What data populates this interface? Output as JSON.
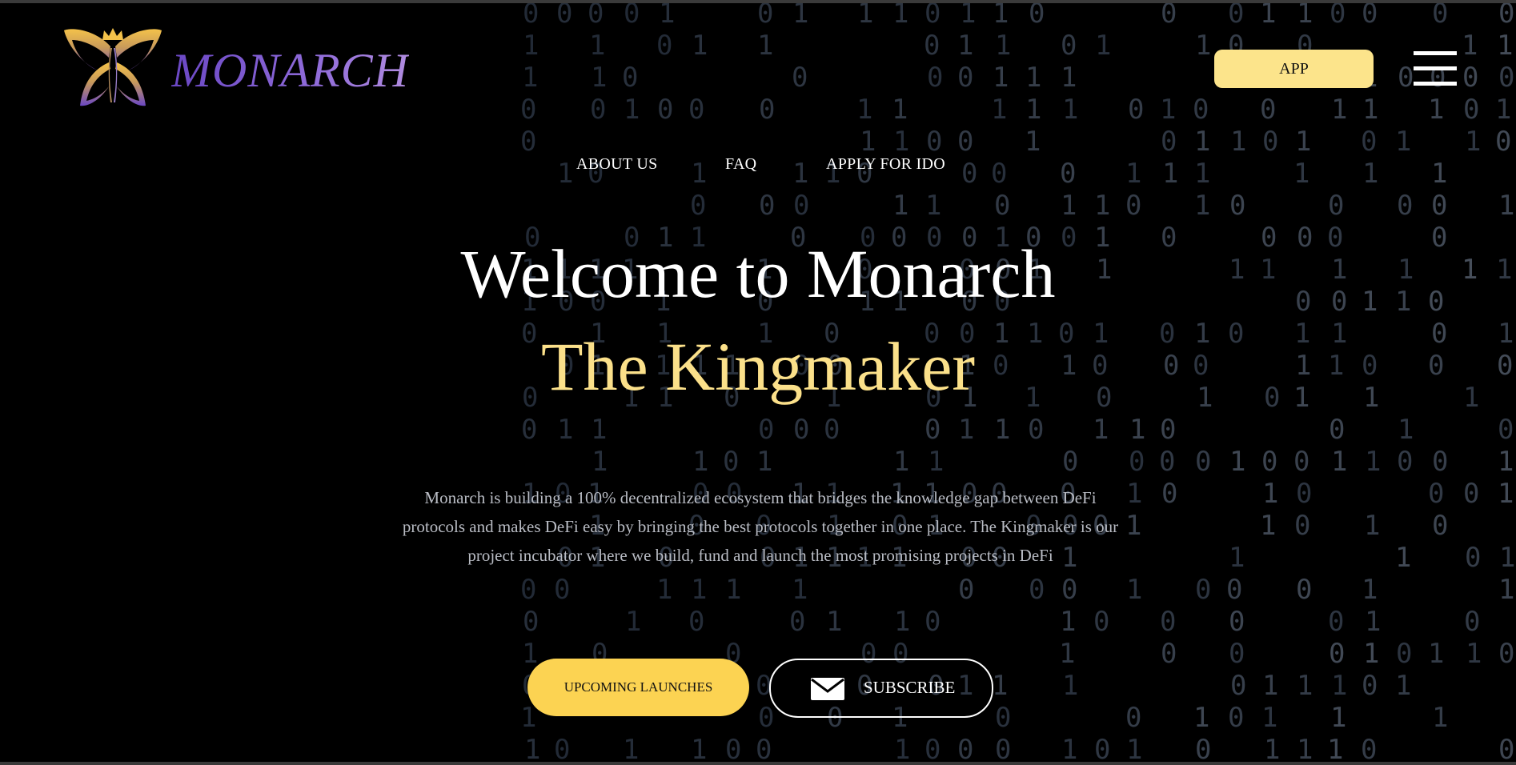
{
  "brand": {
    "name": "MONARCH",
    "logo_icon": "butterfly-crown-icon",
    "colors": {
      "gold": "#f4c24a",
      "purple": "#6a47c4"
    }
  },
  "header": {
    "app_button": "APP",
    "menu_icon": "hamburger-menu-icon"
  },
  "nav": {
    "items": [
      {
        "label": "ABOUT US"
      },
      {
        "label": "FAQ"
      },
      {
        "label": "APPLY FOR IDO"
      }
    ]
  },
  "hero": {
    "title": "Welcome to Monarch",
    "subtitle": "The Kingmaker",
    "description": "Monarch is building a 100% decentralized ecosystem that bridges the knowledge gap between DeFi protocols and makes DeFi easy by bringing the best protocols together in one place. The Kingmaker is our project incubator where we build, fund and launch the most promising projects in DeFi"
  },
  "actions": {
    "launch_button": "UPCOMING LAUNCHES",
    "subscribe_button": "SUBSCRIBE",
    "subscribe_icon": "envelope-icon"
  },
  "theme": {
    "background": "#000000",
    "accent_yellow": "#fcd352",
    "light_yellow": "#fce48b",
    "subtitle_color": "#fbe08a",
    "text_gray": "#b9bcc4"
  }
}
